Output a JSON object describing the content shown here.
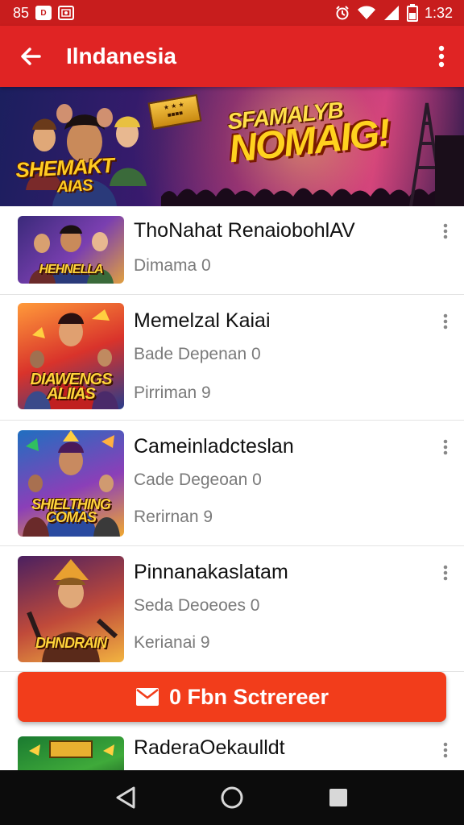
{
  "status_bar": {
    "left_text": "85",
    "icon_1_letter": "D",
    "time": "1:32",
    "icons": [
      "alarm-icon",
      "wifi-icon",
      "signal-icon",
      "battery-icon"
    ]
  },
  "app_bar": {
    "title": "Ilndanesia",
    "back_icon": "arrow-left-icon",
    "more_icon": "more-vertical-icon"
  },
  "hero": {
    "title_line_1": "SFAMALYB",
    "title_line_2": "NOMAIG!",
    "logo_line_1": "SHEMAKT",
    "logo_line_2": "AIAS"
  },
  "list": {
    "items": [
      {
        "title": "ThoNahat RenaiobohlAV",
        "lines": [
          "Dimama 0"
        ],
        "thumb_label": "HEHNELLA",
        "colors": [
          "#3a2a7a",
          "#7a3fb0",
          "#e0a040"
        ]
      },
      {
        "title": "Memelzal Kaiai",
        "lines": [
          "Bade Depenan 0",
          "Pirriman 9"
        ],
        "thumb_label": "DIAWENGS ALIIAS",
        "colors": [
          "#ff9a3a",
          "#d9332b",
          "#2a3c8a"
        ]
      },
      {
        "title": "Cameinladcteslan",
        "lines": [
          "Cade Degeoan 0",
          "Rerirnan 9"
        ],
        "thumb_label": "SHIELTHING COMAS",
        "colors": [
          "#1f6fc0",
          "#8b3fb8",
          "#f0a830"
        ]
      },
      {
        "title": "Pinnanakaslatam",
        "lines": [
          "Seda Deoeoes 0",
          "Kerianai 9"
        ],
        "thumb_label": "DHNDRAIN",
        "colors": [
          "#4a2060",
          "#c04a3a",
          "#f2b440"
        ]
      },
      {
        "title": "RaderaOekaulldt",
        "lines": [],
        "thumb_label": "",
        "colors": [
          "#1a7a30",
          "#3faa3a",
          "#0e3a18"
        ]
      }
    ]
  },
  "cta": {
    "label": "0 Fbn Sctrereer",
    "icon": "mail-icon"
  },
  "nav_bar": {
    "icons": [
      "back-triangle-icon",
      "home-circle-icon",
      "recents-square-icon"
    ]
  }
}
